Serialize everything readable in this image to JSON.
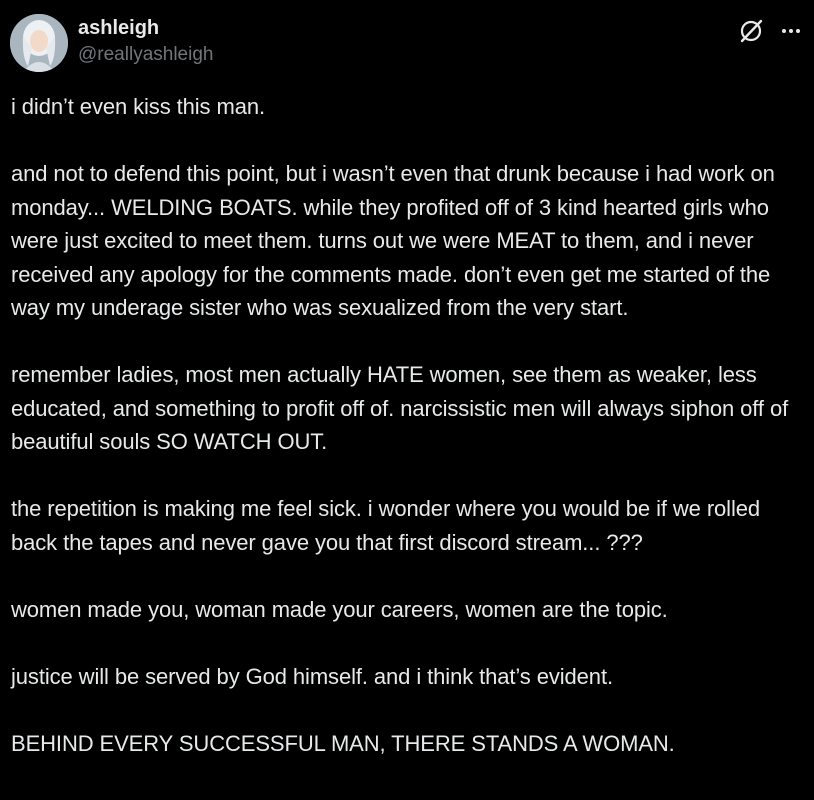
{
  "author": {
    "display_name": "ashleigh",
    "handle": "@reallyashleigh",
    "avatar_icon": "avatar"
  },
  "actions": {
    "grok_icon": "grok-icon",
    "more_icon": "more-icon"
  },
  "tweet": {
    "paragraphs": [
      "i didn’t even kiss this man.",
      "and not to defend this point, but i wasn’t even that drunk because i had work on monday... WELDING BOATS. while they profited off of 3 kind hearted girls who were just excited to meet them. turns out we were MEAT to them, and i never received any apology for the comments made. don’t even get me started of the way my underage sister who was sexualized from the very start.",
      "remember ladies, most men actually HATE women, see them as weaker, less educated, and something to profit off of. narcissistic men will always siphon off of beautiful souls SO WATCH OUT.",
      "the repetition is making me feel sick. i wonder where you would be if we rolled back the tapes and never gave you that first discord stream... ???",
      "women made you, woman made your careers, women are the topic.",
      "justice will be served by God himself. and i think that’s evident.",
      "BEHIND EVERY SUCCESSFUL MAN, THERE STANDS A WOMAN."
    ]
  },
  "colors": {
    "background": "#000000",
    "text_primary": "#e7e9ea",
    "text_secondary": "#71767b"
  }
}
